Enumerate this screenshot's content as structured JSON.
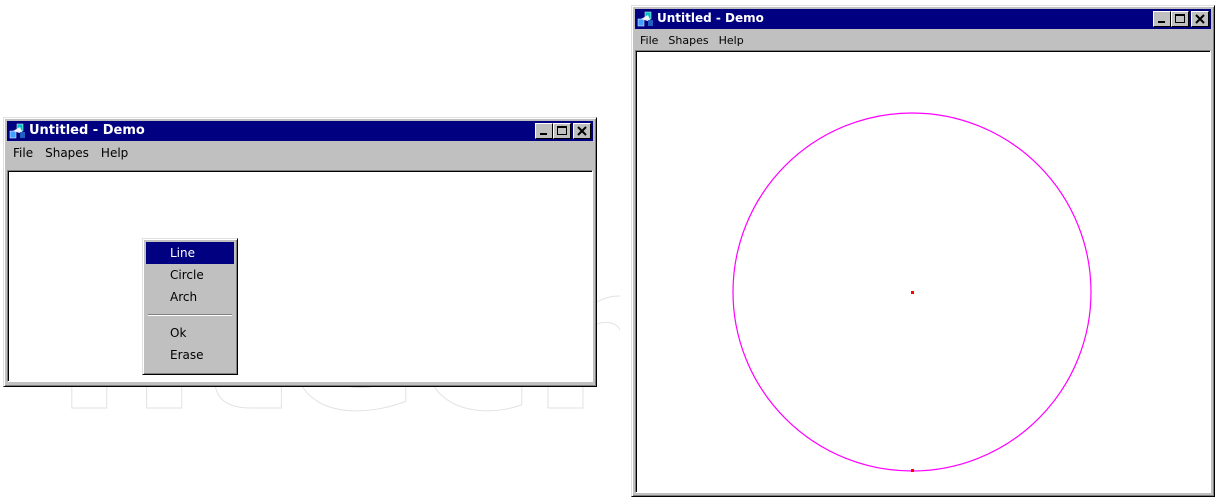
{
  "windows": [
    {
      "title": "Untitled - Demo",
      "menu": [
        "File",
        "Shapes",
        "Help"
      ]
    },
    {
      "title": "Untitled - Demo",
      "menu": [
        "File",
        "Shapes",
        "Help"
      ]
    }
  ],
  "popup_menu": {
    "items": [
      "Line",
      "Circle",
      "Arch"
    ],
    "actions": [
      "Ok",
      "Erase"
    ],
    "selected": "Line"
  },
  "drawing": {
    "shape": "circle",
    "stroke_color": "#ff00ff",
    "center_marker_color": "#ff0000"
  },
  "icons": {
    "app": "app-icon",
    "minimize": "minimize-icon",
    "maximize": "maximize-icon",
    "close": "close-icon"
  },
  "colors": {
    "titlebar": "#000080",
    "face": "#c0c0c0",
    "selection": "#000080"
  }
}
